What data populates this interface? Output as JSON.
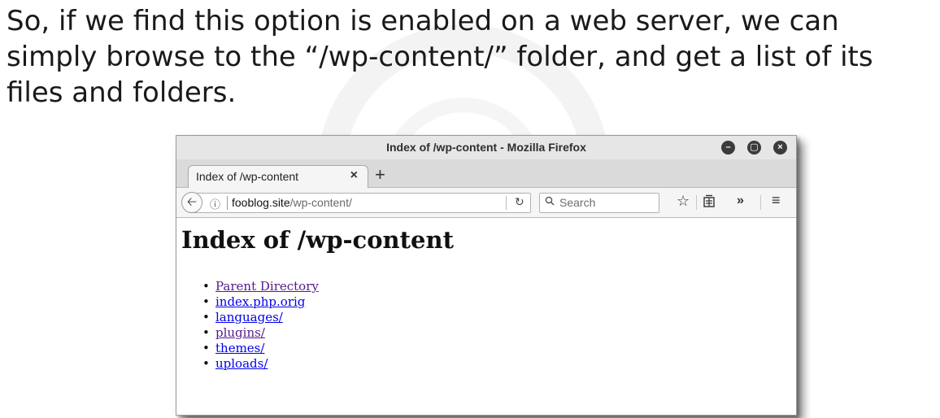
{
  "caption": "So, if we find this option is enabled on a web server, we can simply browse to the “/wp-content/” folder, and get a list of its files and folders.",
  "window": {
    "title": "Index of /wp-content - Mozilla Firefox",
    "tab_label": "Index of /wp-content",
    "tab_close": "×",
    "new_tab": "+",
    "url_host": "fooblog.site",
    "url_path": "/wp-content/",
    "search_placeholder": "Search"
  },
  "page": {
    "heading": "Index of /wp-content",
    "entries": [
      {
        "label": "Parent Directory",
        "color": "#551a8b"
      },
      {
        "label": "index.php.orig",
        "color": "#0000ee"
      },
      {
        "label": "languages/",
        "color": "#0000ee"
      },
      {
        "label": "plugins/",
        "color": "#551a8b"
      },
      {
        "label": "themes/",
        "color": "#0000ee"
      },
      {
        "label": "uploads/",
        "color": "#0000ee"
      }
    ]
  },
  "icons": [
    "minimize-icon",
    "maximize-icon",
    "close-icon",
    "back-icon",
    "info-icon",
    "reload-icon",
    "search-icon",
    "bookmark-star-icon",
    "reading-list-icon",
    "overflow-icon",
    "hamburger-menu-icon"
  ]
}
